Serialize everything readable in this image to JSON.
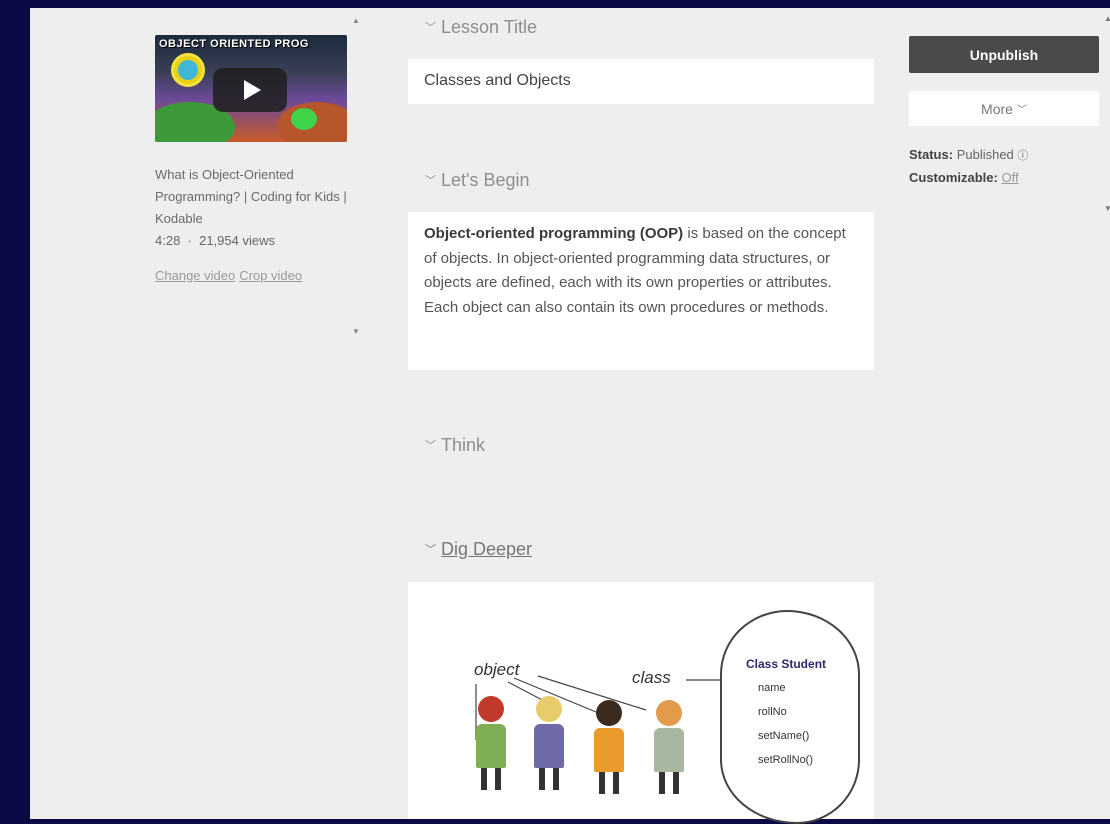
{
  "video": {
    "thumbnail_text": "OBJECT ORIENTED PROG",
    "title": "What is Object-Oriented Programming? | Coding for Kids | Kodable",
    "duration": "4:28",
    "views": "21,954 views",
    "change_label": "Change video",
    "crop_label": "Crop video"
  },
  "sections": {
    "lesson_title": {
      "header": "Lesson Title",
      "value": "Classes and Objects"
    },
    "lets_begin": {
      "header": "Let's Begin",
      "bold": "Object-oriented programming (OOP)",
      "text1": " is based on the concept of objects. In object-oriented programming data structures, or objects are defined, each with its own properties or attributes.",
      "text2": "Each object can also contain its own procedures or methods."
    },
    "think": {
      "header": "Think"
    },
    "dig_deeper": {
      "header": "Dig Deeper"
    }
  },
  "diagram": {
    "object_label": "object",
    "class_label": "class",
    "class_title": "Class Student",
    "members": [
      "name",
      "rollNo",
      "setName()",
      "setRollNo()"
    ]
  },
  "actions": {
    "unpublish": "Unpublish",
    "more": "More",
    "status_label": "Status:",
    "status_value": "Published",
    "customizable_label": "Customizable:",
    "customizable_value": "Off"
  },
  "icons": {
    "section_chevron": "chevron-down-icon",
    "play": "play-icon",
    "help": "help-icon"
  }
}
